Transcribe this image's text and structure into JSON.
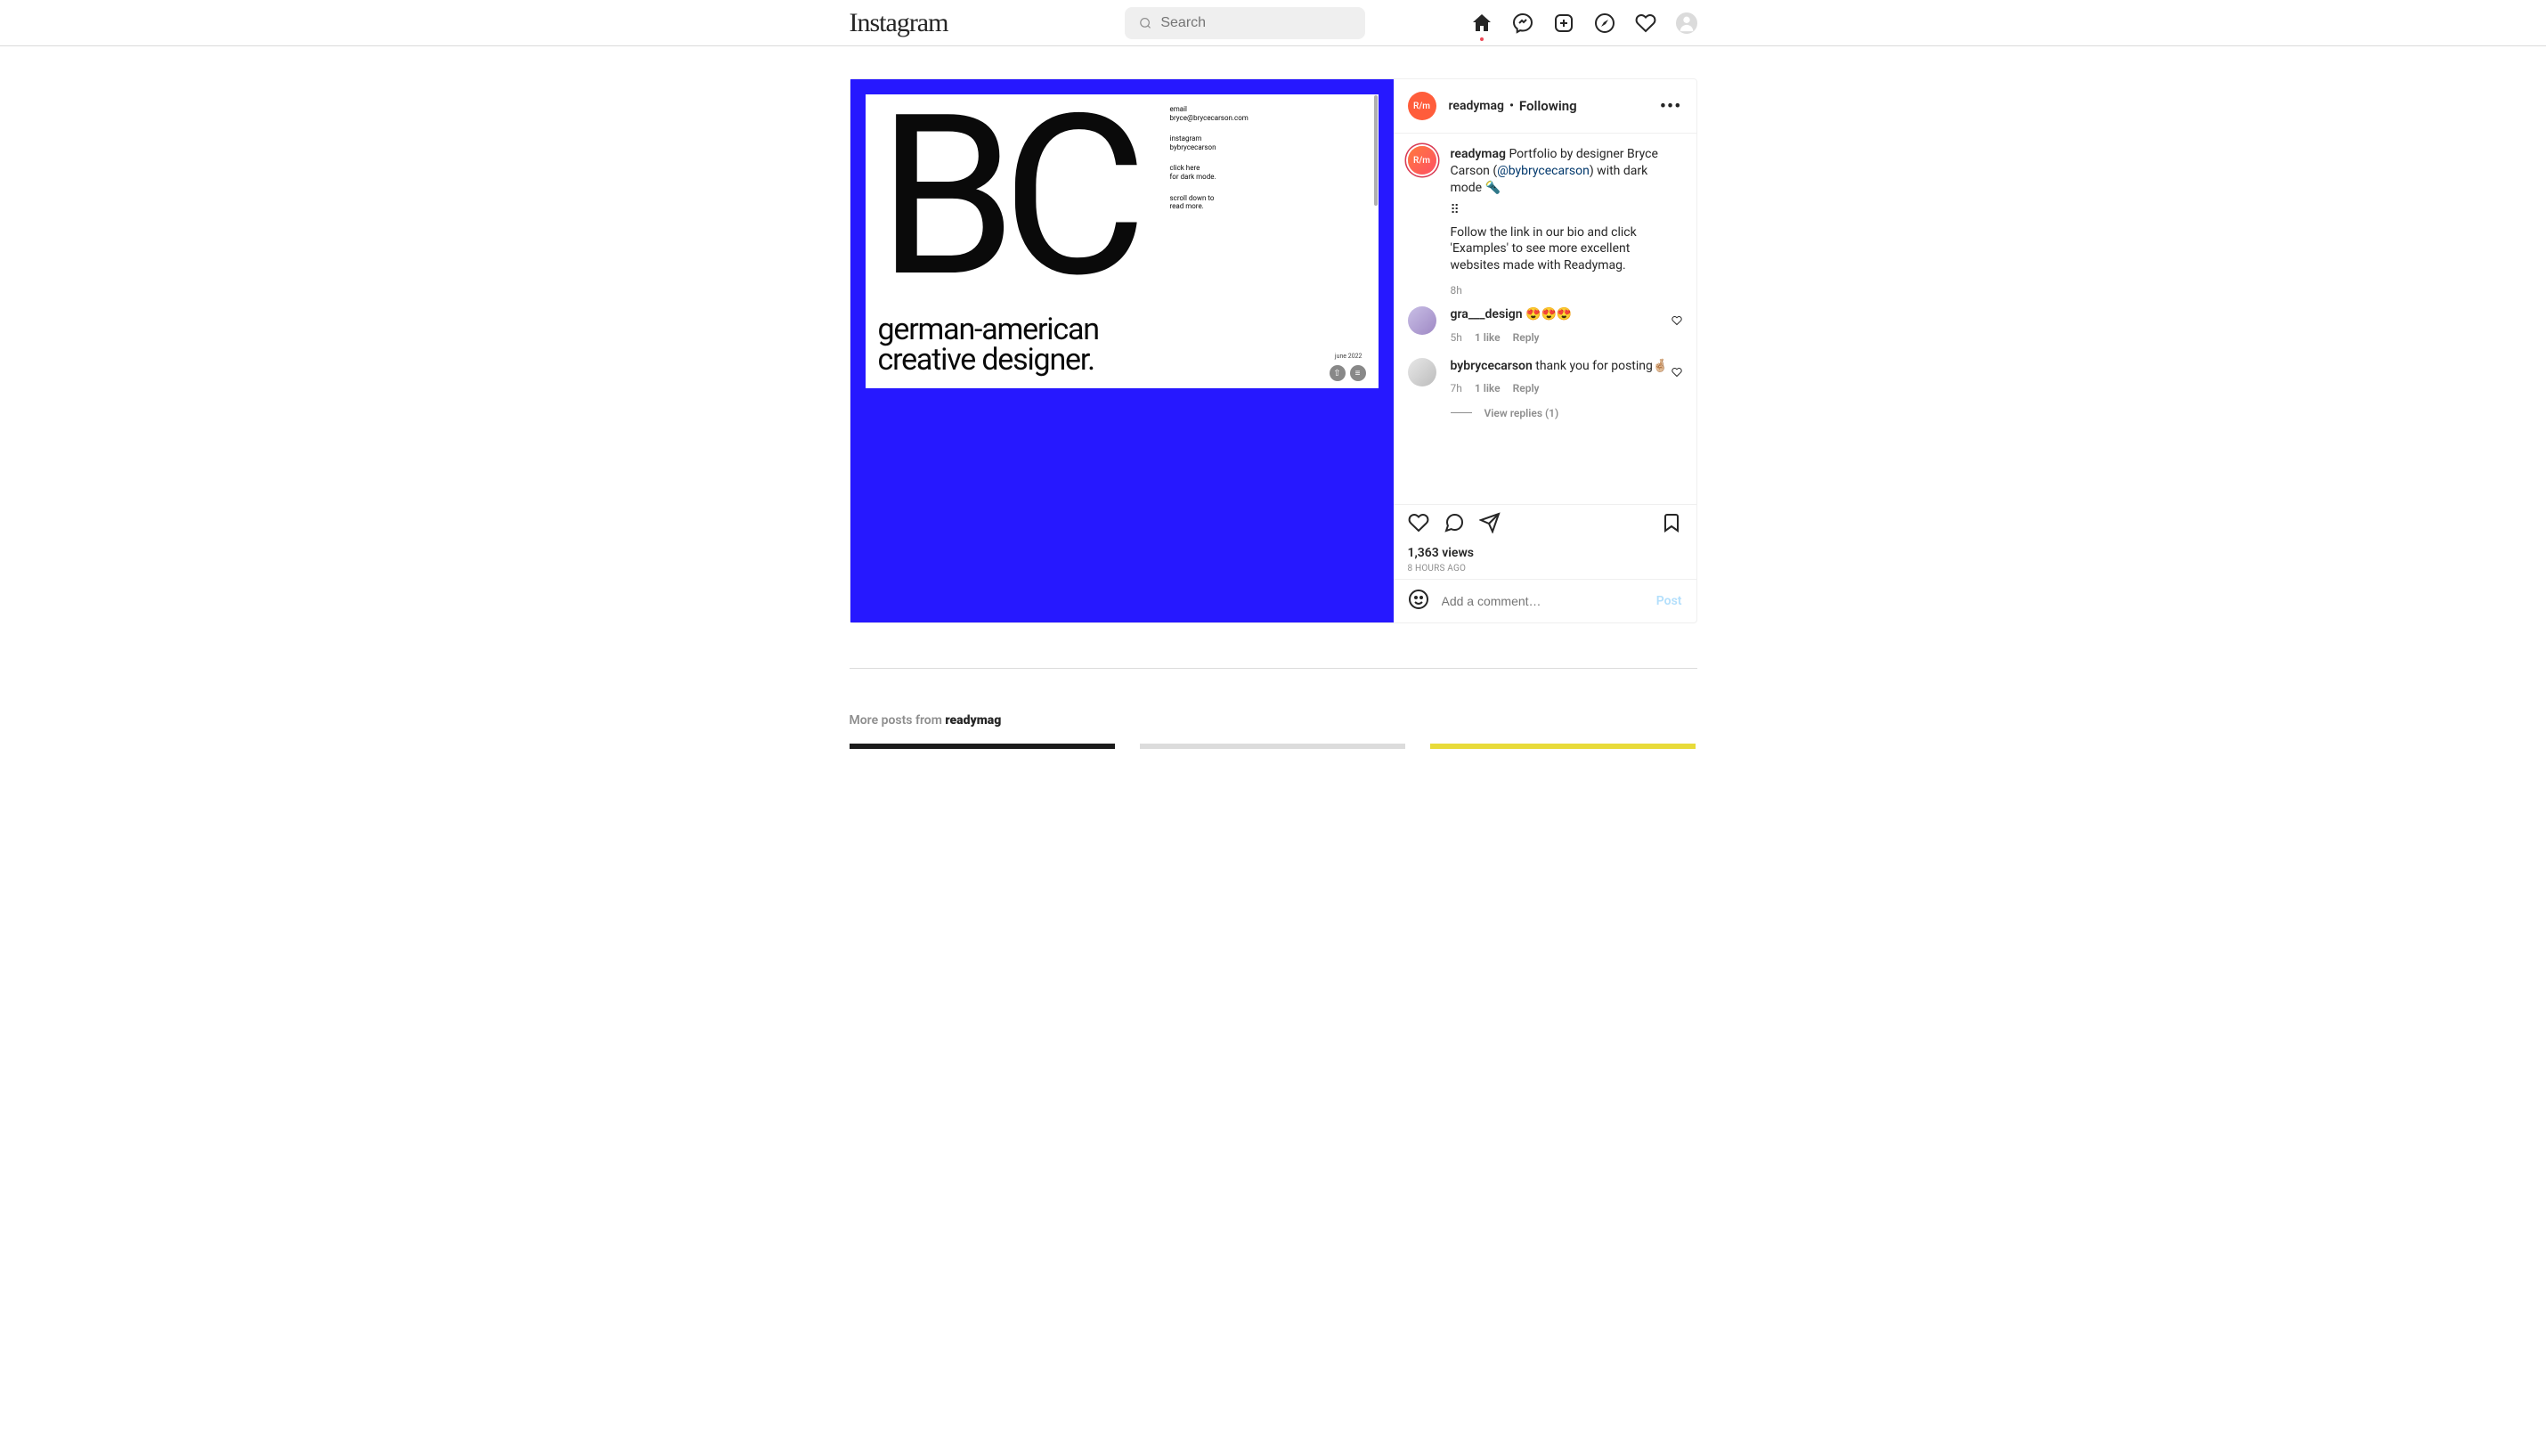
{
  "brand": "Instagram",
  "search": {
    "placeholder": "Search"
  },
  "post": {
    "author": "readymag",
    "author_initials": "R/m",
    "follow_status": "Following",
    "caption_pre": "Portfolio by designer Bryce Carson (",
    "caption_mention": "@bybrycecarson",
    "caption_post": ") with dark mode 🔦",
    "caption_line2": "⠿",
    "caption_line3": "Follow the link in our bio and click 'Examples' to see more excellent websites made with Readymag.",
    "caption_time": "8h",
    "views_label": "1,363 views",
    "time_upper": "8 HOURS AGO",
    "add_comment_placeholder": "Add a comment…",
    "post_button": "Post"
  },
  "media": {
    "big_initials": "BC",
    "side_email_label": "email",
    "side_email_value": "bryce@brycecarson.com",
    "side_ig_label": "instagram",
    "side_ig_value": "bybrycecarson",
    "side_dark_1": "click here",
    "side_dark_2": "for dark mode.",
    "side_scroll_1": "scroll down to",
    "side_scroll_2": "read more.",
    "subtitle_1": "german-american",
    "subtitle_2": "creative designer.",
    "bottom_date": "june 2022"
  },
  "comments": [
    {
      "user": "gra___design",
      "text": " 😍😍😍",
      "time": "5h",
      "likes": "1 like",
      "reply": "Reply"
    },
    {
      "user": "bybrycecarson",
      "text": " thank you for posting🤞🏼",
      "time": "7h",
      "likes": "1 like",
      "reply": "Reply",
      "view_replies": "View replies (1)"
    }
  ],
  "more": {
    "label_pre": "More posts from ",
    "label_user": "readymag"
  }
}
